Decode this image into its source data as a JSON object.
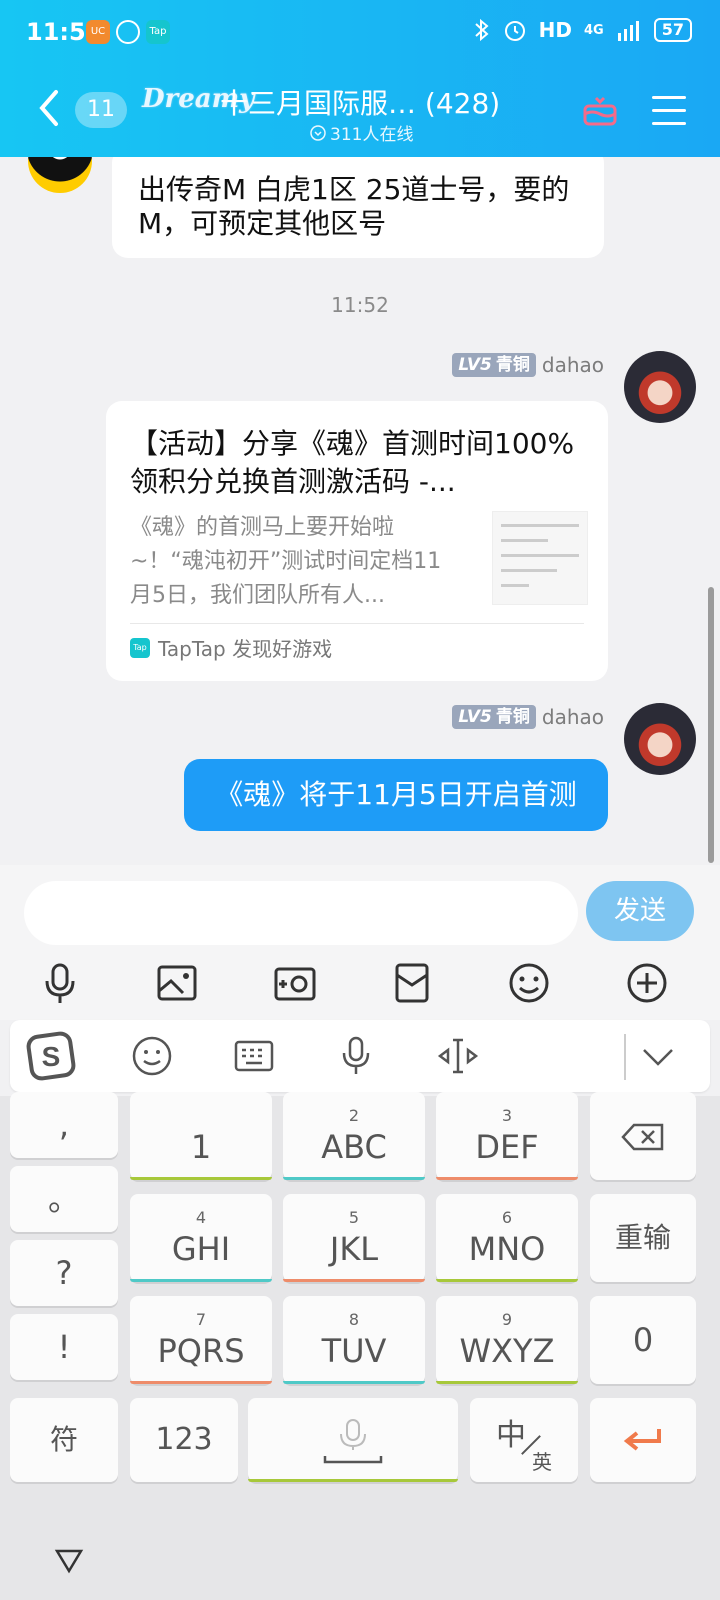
{
  "status_bar": {
    "time": "11:52",
    "network": "HD",
    "network_gen": "4G",
    "battery": "57",
    "app_badge_tap": "Tap"
  },
  "header": {
    "unread_count": "11",
    "logo_text": "Dreamy",
    "group_title": "十三月国际服… (428)",
    "online_text": "311人在线"
  },
  "messages": {
    "msg1_text": "出传奇M 白虎1区 25道士号，要的M，可预定其他区号",
    "timestamp": "11:52",
    "sender_level": "LV5",
    "sender_rank": "青铜",
    "sender_name": "dahao",
    "card": {
      "title": "【活动】分享《魂》首测时间100%领积分兑换首测激活码 -...",
      "description": "《魂》的首测马上要开始啦~！“魂沌初开”测试时间定档11月5日，我们团队所有人...",
      "source": "TapTap 发现好游戏",
      "badge": "Tap"
    },
    "msg2_text": "《魂》将于11月5日开启首测"
  },
  "input": {
    "placeholder": "",
    "send_label": "发送"
  },
  "keyboard": {
    "punct": [
      ",",
      "。",
      "?",
      "!"
    ],
    "keys": [
      {
        "num": "",
        "label": "1"
      },
      {
        "num": "2",
        "label": "ABC"
      },
      {
        "num": "3",
        "label": "DEF"
      },
      {
        "num": "4",
        "label": "GHI"
      },
      {
        "num": "5",
        "label": "JKL"
      },
      {
        "num": "6",
        "label": "MNO"
      },
      {
        "num": "7",
        "label": "PQRS"
      },
      {
        "num": "8",
        "label": "TUV"
      },
      {
        "num": "9",
        "label": "WXYZ"
      }
    ],
    "reenter": "重输",
    "zero": "0",
    "symbols": "符",
    "numbers": "123",
    "lang_main": "中",
    "lang_alt": "英"
  },
  "colors": {
    "header_start": "#17c6f3",
    "header_end": "#1aa8f4",
    "blue_bubble": "#1e9cf7",
    "send_button": "#7ec5f1",
    "underline_green": "#a7c83a",
    "underline_teal": "#4fc9c7",
    "underline_orange": "#ee8c6a",
    "enter_orange": "#f07a4b"
  }
}
